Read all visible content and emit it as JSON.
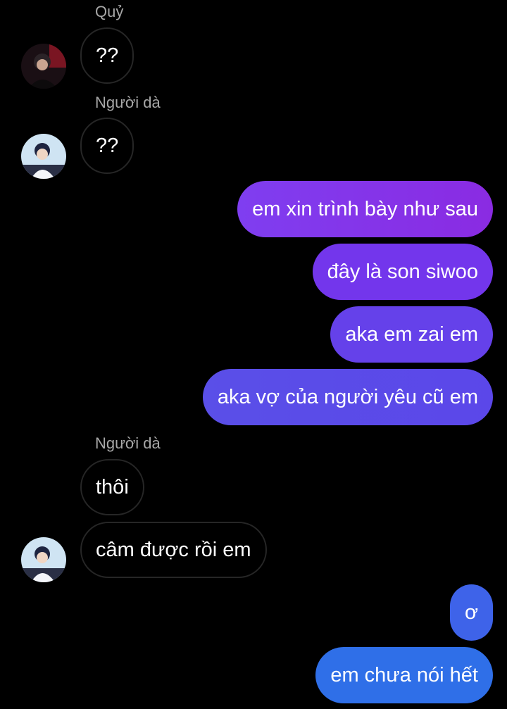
{
  "conversation": {
    "groups": [
      {
        "sender": "Quỷ",
        "avatar": "avatar-icon",
        "messages": [
          "??"
        ]
      },
      {
        "sender": "Người dà",
        "avatar": "avatar-icon",
        "messages": [
          "??"
        ]
      },
      {
        "sender": "",
        "messages": [
          "em xin trình bày như sau",
          "đây là son siwoo",
          "aka em zai em",
          "aka vợ của người yêu cũ em"
        ]
      },
      {
        "sender": "Người dà",
        "avatar": "avatar-icon",
        "messages": [
          "thôi",
          "câm được rồi em"
        ]
      },
      {
        "sender": "",
        "messages": [
          "ơ",
          "em chưa nói hết"
        ]
      }
    ]
  },
  "colors": {
    "background": "#000000",
    "incoming_border": "#262626",
    "sender_name": "#a8a8a8",
    "outgoing_purple": "#8a2be2",
    "outgoing_indigo": "#5b4fe8",
    "outgoing_blue": "#2f6fe8"
  }
}
